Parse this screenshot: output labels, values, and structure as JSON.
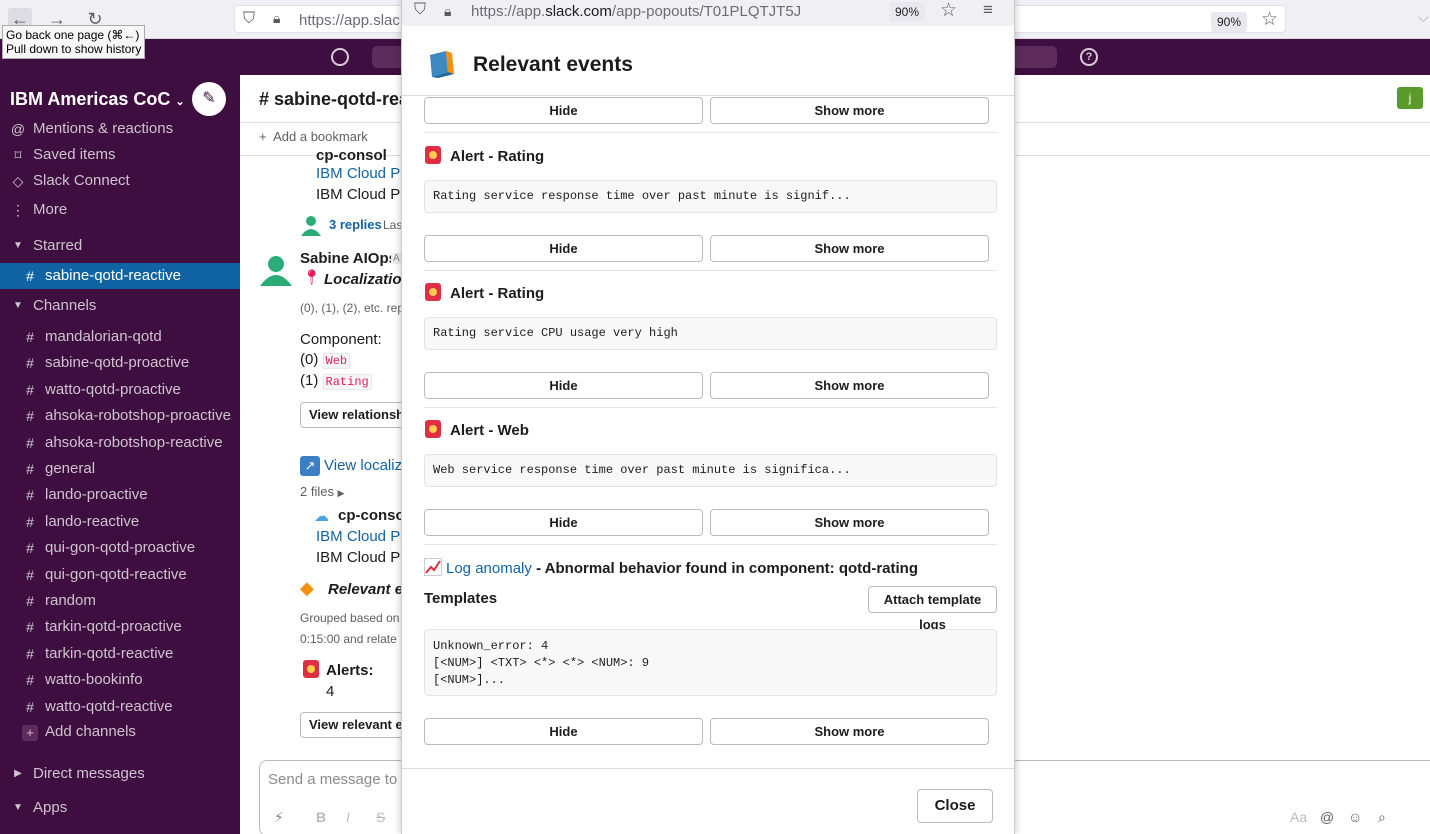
{
  "browser": {
    "url_prefix": "https://app.",
    "url_domain": "slack.com",
    "url_path": "/app-popouts/T01PLQTJT5J",
    "back_url": "https://app.slac",
    "zoom": "90%",
    "tooltip_line1": "Go back one page (⌘←)",
    "tooltip_line2": "Pull down to show history"
  },
  "workspace": {
    "name": "IBM Americas CoC"
  },
  "sidebar": {
    "nav": [
      {
        "icon": "@",
        "label": "Mentions & reactions"
      },
      {
        "icon": "⌑",
        "label": "Saved items"
      },
      {
        "icon": "◇",
        "label": "Slack Connect"
      },
      {
        "icon": "⋮",
        "label": "More"
      }
    ],
    "starred_header": "Starred",
    "starred": [
      {
        "label": "sabine-qotd-reactive"
      }
    ],
    "channels_header": "Channels",
    "channels": [
      "mandalorian-qotd",
      "sabine-qotd-proactive",
      "watto-qotd-proactive",
      "ahsoka-robotshop-proactive",
      "ahsoka-robotshop-reactive",
      "general",
      "lando-proactive",
      "lando-reactive",
      "qui-gon-qotd-proactive",
      "qui-gon-qotd-reactive",
      "random",
      "tarkin-qotd-proactive",
      "tarkin-qotd-reactive",
      "watto-bookinfo",
      "watto-qotd-reactive"
    ],
    "add_channels": "Add channels",
    "direct_messages": "Direct messages",
    "apps": "Apps"
  },
  "channel": {
    "title": "# sabine-qotd-reac",
    "add_bookmark": "Add a bookmark",
    "avatar_letter": "j",
    "messages": {
      "file_title_top": "cp-consol",
      "link1": "IBM Cloud Pa",
      "text1": "IBM Cloud Pa",
      "replies": "3 replies",
      "replies_suffix": "Las",
      "sender": "Sabine AIOps",
      "sender_badge": "A",
      "localization": "Localization",
      "note": "(0), (1), (2), etc. rep",
      "component_label": "Component:",
      "comp0_idx": "(0)",
      "comp0": "Web",
      "comp1_idx": "(1)",
      "comp1": "Rating",
      "view_relationships": "View relationship",
      "view_localization": "View localiz",
      "files": "2 files",
      "file2_title": "cp-consol",
      "link2": "IBM Cloud Pa",
      "text2": "IBM Cloud Pa",
      "relevant": "Relevant eve",
      "grouped1": "Grouped based on",
      "grouped2": "0:15:00 and relate",
      "alerts_label": "Alerts:",
      "alerts_count": "4",
      "view_relevant": "View relevant ev"
    },
    "composer_placeholder": "Send a message to #s"
  },
  "popout": {
    "title": "Relevant events",
    "hide": "Hide",
    "show_more": "Show more",
    "alerts": [
      {
        "title": "Alert - Rating",
        "text": "Rating service response time over past minute is signif..."
      },
      {
        "title": "Alert - Rating",
        "text": "Rating service CPU usage very high"
      },
      {
        "title": "Alert - Web",
        "text": "Web service response time over past minute is significa..."
      }
    ],
    "log_anomaly_link": "Log anomaly",
    "log_anomaly_text": " - Abnormal behavior found in component: qotd-rating",
    "templates_label": "Templates",
    "attach_button": "Attach template logs",
    "templates_text": "Unknown_error: 4\n[<NUM>] <TXT> <*> <*> <NUM>: 9\n[<NUM>]...",
    "close": "Close"
  },
  "colors": {
    "sidebar_bg": "#3f0e40",
    "active_item": "#1164a3",
    "link": "#1264a3",
    "alert_red": "#e01e5a"
  }
}
